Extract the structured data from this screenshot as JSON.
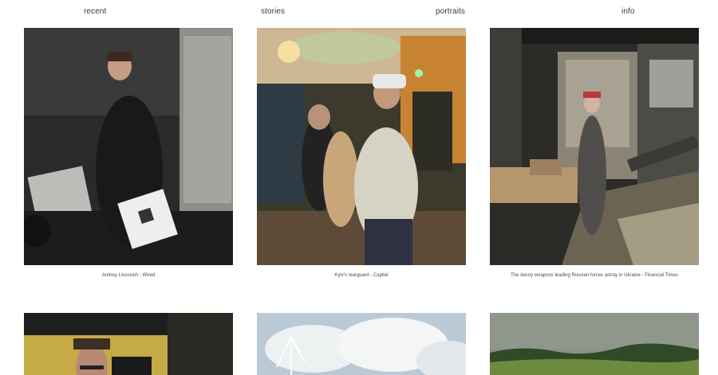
{
  "nav": {
    "recent": "recent",
    "stories": "stories",
    "portraits": "portraits",
    "info": "info"
  },
  "gallery": {
    "items": [
      {
        "caption": "Andrey Liscovich - Wired"
      },
      {
        "caption": "Kyiv's rearguard - Capital"
      },
      {
        "caption": "The decoy weapons leading Russian forces astray in Ukraine - Financial Times"
      },
      {
        "caption": ""
      },
      {
        "caption": ""
      },
      {
        "caption": ""
      }
    ]
  },
  "colors": {
    "background": "#ffffff",
    "nav_text": "#3a3a3a",
    "caption_text": "#4a4a4a"
  }
}
